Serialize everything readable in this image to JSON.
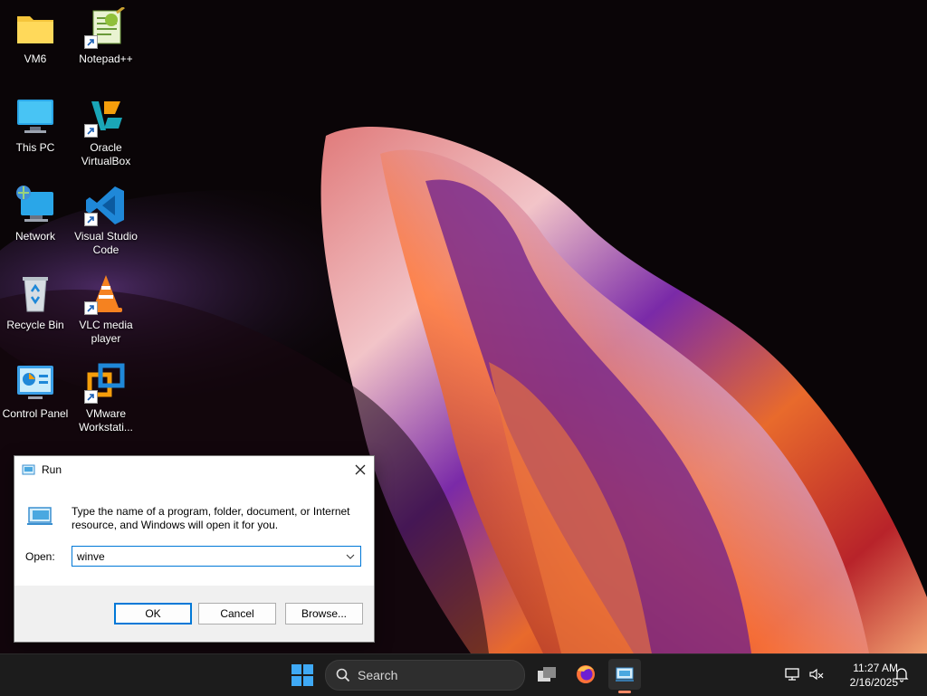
{
  "desktop": {
    "icons": [
      {
        "label": "VM6",
        "icon": "folder-icon"
      },
      {
        "label": "Notepad++",
        "icon": "notepad-plus-plus-icon"
      },
      {
        "label": "This PC",
        "icon": "monitor-icon"
      },
      {
        "label": "Oracle VirtualBox",
        "icon": "virtualbox-icon"
      },
      {
        "label": "Network",
        "icon": "network-icon"
      },
      {
        "label": "Visual Studio Code",
        "icon": "vscode-icon"
      },
      {
        "label": "Recycle Bin",
        "icon": "recycle-bin-icon"
      },
      {
        "label": "VLC media player",
        "icon": "vlc-icon"
      },
      {
        "label": "Control Panel",
        "icon": "control-panel-icon"
      },
      {
        "label": "VMware Workstati...",
        "icon": "vmware-icon"
      }
    ]
  },
  "run_dialog": {
    "title": "Run",
    "description": "Type the name of a program, folder, document, or Internet resource, and Windows will open it for you.",
    "open_label": "Open:",
    "open_value": "winve",
    "ok_label": "OK",
    "cancel_label": "Cancel",
    "browse_label": "Browse..."
  },
  "taskbar": {
    "search_placeholder": "Search",
    "time": "11:27 AM",
    "date": "2/16/2025",
    "apps": [
      "start-icon",
      "task-view-icon",
      "firefox-icon",
      "run-icon"
    ],
    "tray": [
      "network-icon",
      "volume-muted-icon",
      "notification-bell-icon"
    ]
  },
  "colors": {
    "accent": "#0078d7",
    "taskbar": "#1c1c1c",
    "wallpaper_bg": "#0a0507"
  }
}
